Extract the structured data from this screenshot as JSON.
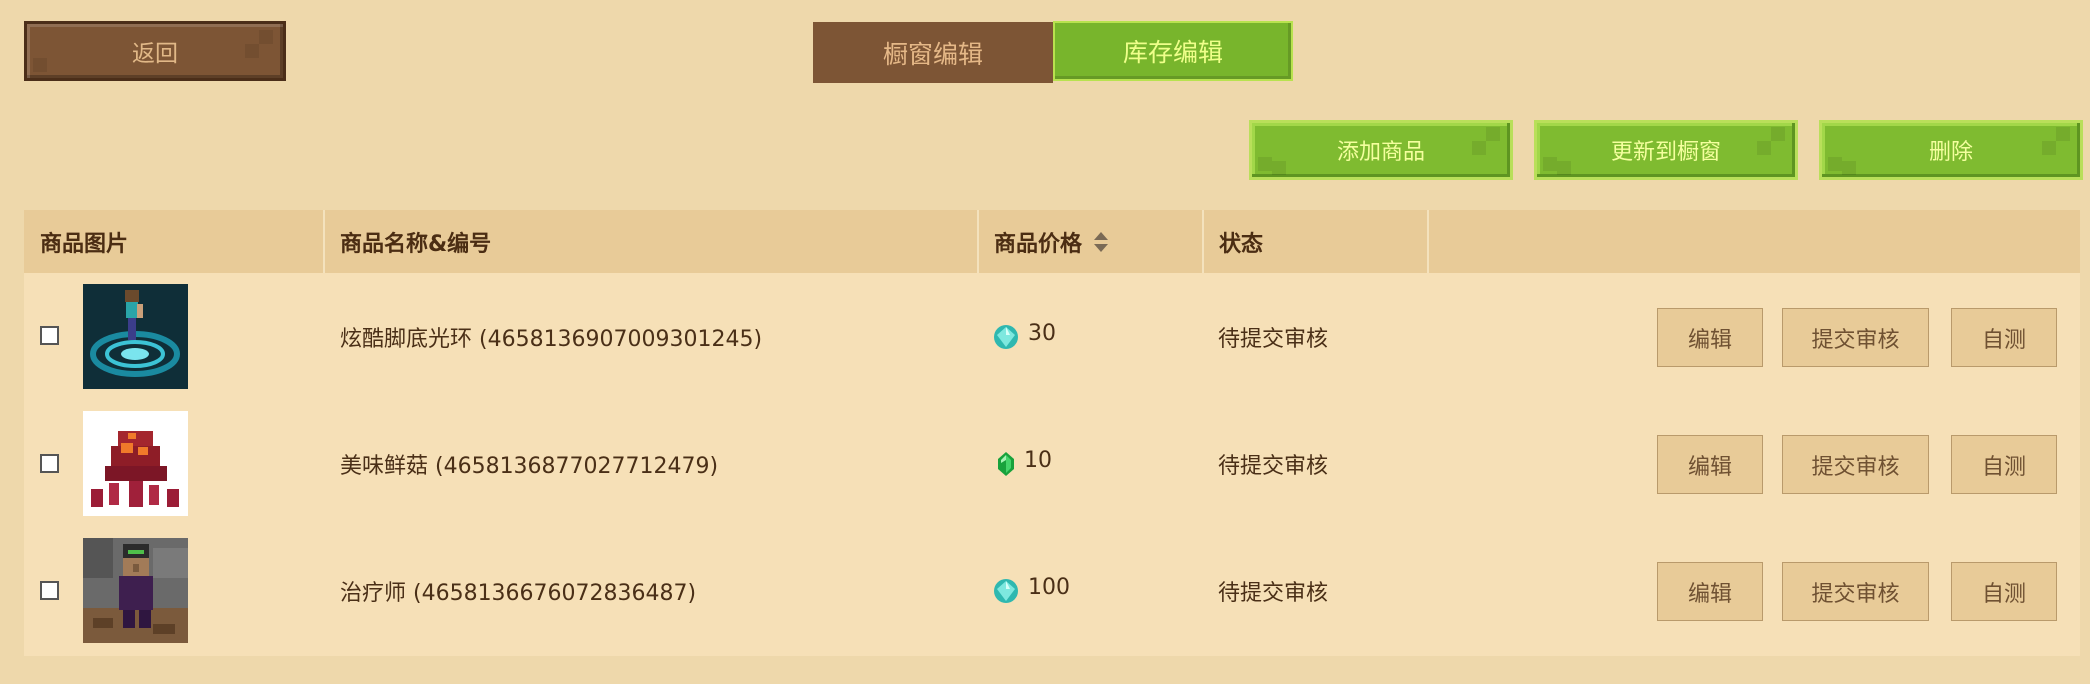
{
  "toolbar": {
    "back_label": "返回",
    "add_label": "添加商品",
    "update_label": "更新到橱窗",
    "delete_label": "删除"
  },
  "tabs": {
    "showcase": "橱窗编辑",
    "inventory": "库存编辑",
    "active": "inventory"
  },
  "table": {
    "headers": {
      "image": "商品图片",
      "name": "商品名称&编号",
      "price": "商品价格",
      "status": "状态"
    },
    "rows": [
      {
        "name": "炫酷脚底光环 (4658136907009301245)",
        "currency_icon": "diamond-icon",
        "price": "30",
        "status": "待提交审核",
        "edit": "编辑",
        "submit": "提交审核",
        "test": "自测"
      },
      {
        "name": "美味鲜菇 (4658136877027712479)",
        "currency_icon": "emerald-icon",
        "price": "10",
        "status": "待提交审核",
        "edit": "编辑",
        "submit": "提交审核",
        "test": "自测"
      },
      {
        "name": "治疗师 (4658136676072836487)",
        "currency_icon": "diamond-icon",
        "price": "100",
        "status": "待提交审核",
        "edit": "编辑",
        "submit": "提交审核",
        "test": "自测"
      }
    ]
  },
  "colors": {
    "background": "#eed8ab",
    "brown_button": "#7d5535",
    "green_button": "#7fbb30",
    "header_bg": "#e8cb98",
    "row_bg": "#f6e0b7"
  }
}
